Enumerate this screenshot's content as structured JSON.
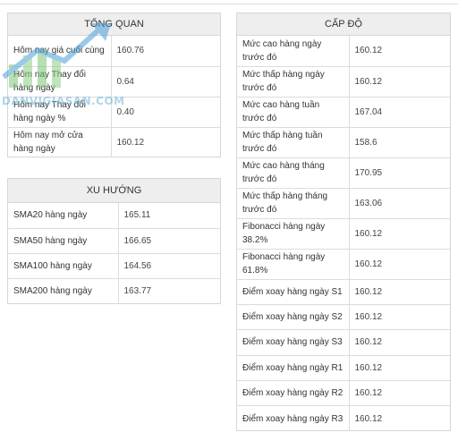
{
  "overview": {
    "title": "TỔNG QUAN",
    "rows": [
      {
        "label": "Hôm nay giá cuối cùng",
        "value": "160.76"
      },
      {
        "label": "Hôm nay Thay đổi hàng ngày",
        "value": "0.64"
      },
      {
        "label": "Hôm nay Thay đổi hàng ngày %",
        "value": "0.40"
      },
      {
        "label": "Hôm nay mở cửa hàng ngày",
        "value": "160.12"
      }
    ]
  },
  "trend": {
    "title": "XU HƯỚNG",
    "rows": [
      {
        "label": "SMA20 hàng ngày",
        "value": "165.11"
      },
      {
        "label": "SMA50 hàng ngày",
        "value": "166.65"
      },
      {
        "label": "SMA100 hàng ngày",
        "value": "164.56"
      },
      {
        "label": "SMA200 hàng ngày",
        "value": "163.77"
      }
    ]
  },
  "levels": {
    "title": "CẤP ĐỘ",
    "rows": [
      {
        "label": "Mức cao hàng ngày trước đó",
        "value": "160.12"
      },
      {
        "label": "Mức thấp hàng ngày trước đó",
        "value": "160.12"
      },
      {
        "label": "Mức cao hàng tuần trước đó",
        "value": "167.04"
      },
      {
        "label": "Mức thấp hàng tuần trước đó",
        "value": "158.6"
      },
      {
        "label": "Mức cao hàng tháng trước đó",
        "value": "170.95"
      },
      {
        "label": "Mức thấp hàng tháng trước đó",
        "value": "163.06"
      },
      {
        "label": "Fibonacci hàng ngày 38.2%",
        "value": "160.12"
      },
      {
        "label": "Fibonacci hàng ngày 61.8%",
        "value": "160.12"
      },
      {
        "label": "Điểm xoay hàng ngày S1",
        "value": "160.12"
      },
      {
        "label": "Điểm xoay hàng ngày S2",
        "value": "160.12"
      },
      {
        "label": "Điểm xoay hàng ngày S3",
        "value": "160.12"
      },
      {
        "label": "Điểm xoay hàng ngày R1",
        "value": "160.12"
      },
      {
        "label": "Điểm xoay hàng ngày R2",
        "value": "160.12"
      },
      {
        "label": "Điểm xoay hàng ngày R3",
        "value": "160.12"
      }
    ]
  },
  "watermark": {
    "text": "DANVIGIASAN.COM",
    "color": "#6fb3d9",
    "accent": "#7cc576"
  },
  "colors": {
    "header_bg": "#eeeeee",
    "border": "#d6d6d6",
    "text": "#333333"
  }
}
